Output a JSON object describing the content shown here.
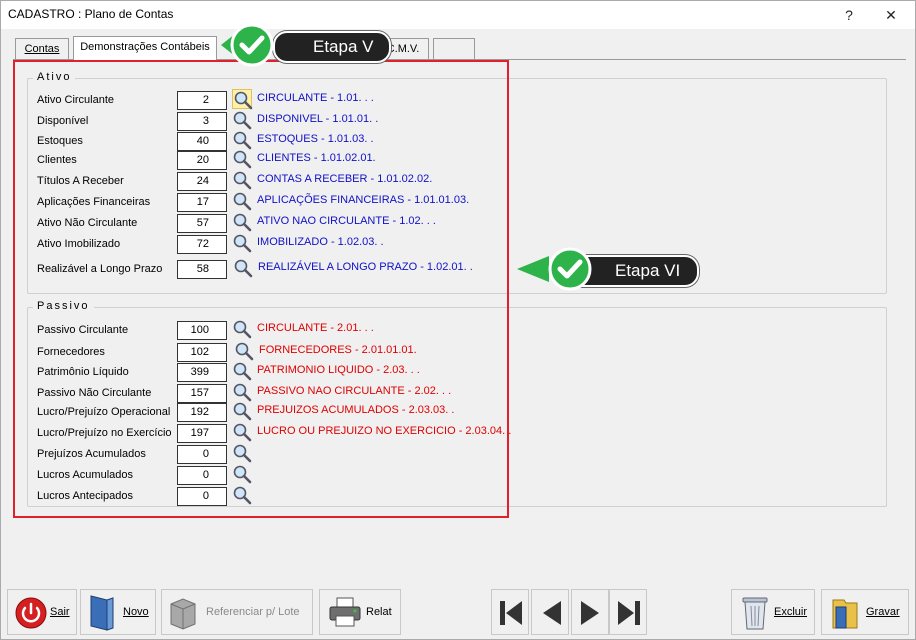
{
  "window": {
    "title": "CADASTRO : Plano de Contas",
    "help_label": "?",
    "close_label": "✕"
  },
  "tabs": [
    {
      "label": "Contas"
    },
    {
      "label": "Demonstrações Contábeis"
    },
    {
      "label": "C.M.V."
    },
    {
      "label": ""
    }
  ],
  "callouts": {
    "etapa_v": "Etapa V",
    "etapa_vi": "Etapa VI"
  },
  "ativo": {
    "title": "Ativo",
    "rows": [
      {
        "label": "Ativo Circulante",
        "value": "2",
        "account": "CIRCULANTE - 1.01.  .  ."
      },
      {
        "label": "Disponível",
        "value": "3",
        "account": "DISPONIVEL - 1.01.01.  ."
      },
      {
        "label": "Estoques",
        "value": "40",
        "account": "ESTOQUES - 1.01.03.  ."
      },
      {
        "label": "Clientes",
        "value": "20",
        "account": "CLIENTES - 1.01.02.01."
      },
      {
        "label": "Títulos A Receber",
        "value": "24",
        "account": "CONTAS A RECEBER - 1.01.02.02."
      },
      {
        "label": "Aplicações Financeiras",
        "value": "17",
        "account": "APLICAÇÕES FINANCEIRAS - 1.01.01.03."
      },
      {
        "label": "Ativo Não Circulante",
        "value": "57",
        "account": "ATIVO NAO CIRCULANTE - 1.02.  .  ."
      },
      {
        "label": "Ativo Imobilizado",
        "value": "72",
        "account": "IMOBILIZADO - 1.02.03.  ."
      },
      {
        "label": "Realizável a Longo Prazo",
        "value": "58",
        "account": "REALIZÁVEL A LONGO PRAZO - 1.02.01.  ."
      }
    ]
  },
  "passivo": {
    "title": "Passivo",
    "rows": [
      {
        "label": "Passivo Circulante",
        "value": "100",
        "account": "CIRCULANTE - 2.01.  .  ."
      },
      {
        "label": "Fornecedores",
        "value": "102",
        "account": "FORNECEDORES - 2.01.01.01."
      },
      {
        "label": "Patrimônio Líquido",
        "value": "399",
        "account": "PATRIMONIO LIQUIDO - 2.03.  .  ."
      },
      {
        "label": "Passivo Não Circulante",
        "value": "157",
        "account": "PASSIVO NAO CIRCULANTE - 2.02.  .  ."
      },
      {
        "label": "Lucro/Prejuízo Operacional",
        "value": "192",
        "account": "PREJUIZOS ACUMULADOS - 2.03.03.  ."
      },
      {
        "label": "Lucro/Prejuízo no Exercício",
        "value": "197",
        "account": "LUCRO OU PREJUIZO NO EXERCICIO - 2.03.04.  ."
      },
      {
        "label": "Prejuízos Acumulados",
        "value": "0",
        "account": ""
      },
      {
        "label": "Lucros Acumulados",
        "value": "0",
        "account": ""
      },
      {
        "label": "Lucros Antecipados",
        "value": "0",
        "account": ""
      }
    ]
  },
  "toolbar": {
    "sair": "Sair",
    "novo": "Novo",
    "referenciar": "Referenciar p/ Lote",
    "relat": "Relat",
    "excluir": "Excluir",
    "gravar": "Gravar"
  },
  "colors": {
    "ativo_account": "#1010c8",
    "passivo_account": "#e00000",
    "frame": "#e0202a",
    "callout_green": "#2db34a"
  }
}
